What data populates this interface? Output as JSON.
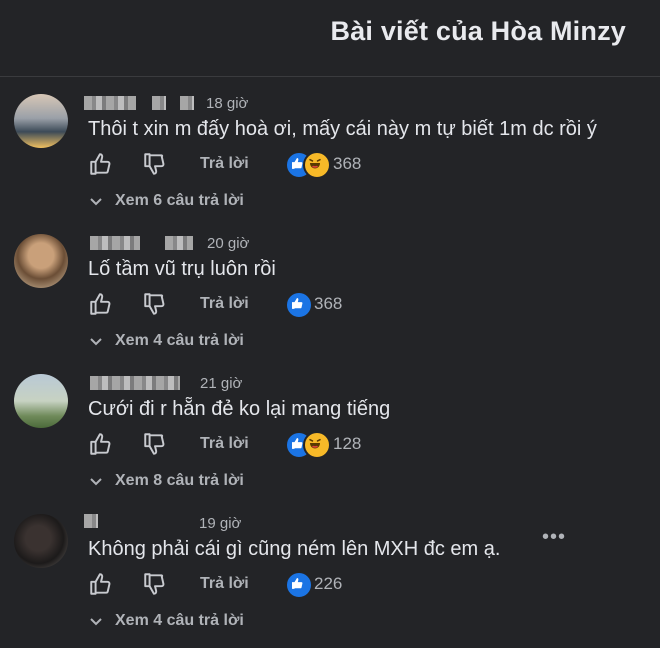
{
  "header": {
    "title": "Bài viết của Hòa Minzy"
  },
  "actions": {
    "reply_label": "Trả lời"
  },
  "comments": [
    {
      "time": "18 giờ",
      "text": "Thôi t xin m đấy hoà ơi, mấy cái này m tự biết 1m dc rồi ý",
      "reactions": [
        "like-icon",
        "haha-icon"
      ],
      "reaction_count": "368",
      "view_replies": "Xem 6 câu trả lời"
    },
    {
      "time": "20 giờ",
      "text": "Lố tầm vũ trụ luôn rồi",
      "reactions": [
        "like-icon"
      ],
      "reaction_count": "368",
      "view_replies": "Xem 4 câu trả lời"
    },
    {
      "time": "21 giờ",
      "text": "Cưới đi r hẵn đẻ ko lại mang tiếng",
      "reactions": [
        "like-icon",
        "haha-icon"
      ],
      "reaction_count": "128",
      "view_replies": "Xem 8 câu trả lời"
    },
    {
      "time": "19 giờ",
      "text": "Không phải cái gì cũng ném lên MXH đc em ạ.",
      "reactions": [
        "like-icon"
      ],
      "reaction_count": "226",
      "view_replies": "Xem 4 câu trả lời"
    }
  ],
  "colors": {
    "background": "#232427",
    "like": "#1b74e4",
    "haha": "#f7b928",
    "muted": "#b0b3b8"
  }
}
